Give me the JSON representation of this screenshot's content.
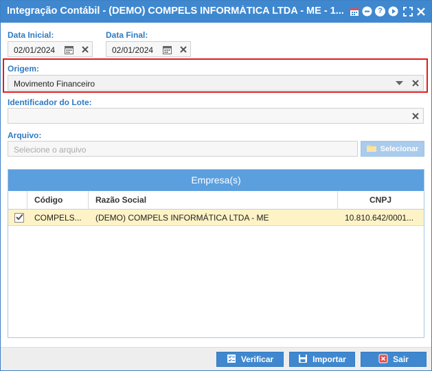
{
  "window": {
    "title": "Integração Contábil - (DEMO) COMPELS INFORMÁTICA LTDA - ME - 1...",
    "icons": [
      "calendar-icon",
      "minimize-icon",
      "help-icon",
      "play-icon",
      "maximize-icon",
      "close-icon"
    ]
  },
  "form": {
    "data_inicial": {
      "label": "Data Inicial:",
      "value": "02/01/2024"
    },
    "data_final": {
      "label": "Data Final:",
      "value": "02/01/2024"
    },
    "origem": {
      "label": "Origem:",
      "value": "Movimento Financeiro"
    },
    "identificador_lote": {
      "label": "Identificador do Lote:",
      "value": ""
    },
    "arquivo": {
      "label": "Arquivo:",
      "placeholder": "Selecione o arquivo",
      "button_label": "Selecionar"
    }
  },
  "grid": {
    "title": "Empresa(s)",
    "columns": [
      "Código",
      "Razão Social",
      "CNPJ"
    ],
    "rows": [
      {
        "checked": true,
        "codigo": "COMPELS...",
        "razao_social": "(DEMO) COMPELS INFORMÁTICA LTDA - ME",
        "cnpj": "10.810.642/0001..."
      }
    ]
  },
  "footer": {
    "verificar": "Verificar",
    "importar": "Importar",
    "sair": "Sair"
  },
  "colors": {
    "title_bar": "#3f88d0",
    "label": "#2f7ac2",
    "highlight_border": "#e01b1b",
    "selected_row": "#fdf3c6"
  }
}
